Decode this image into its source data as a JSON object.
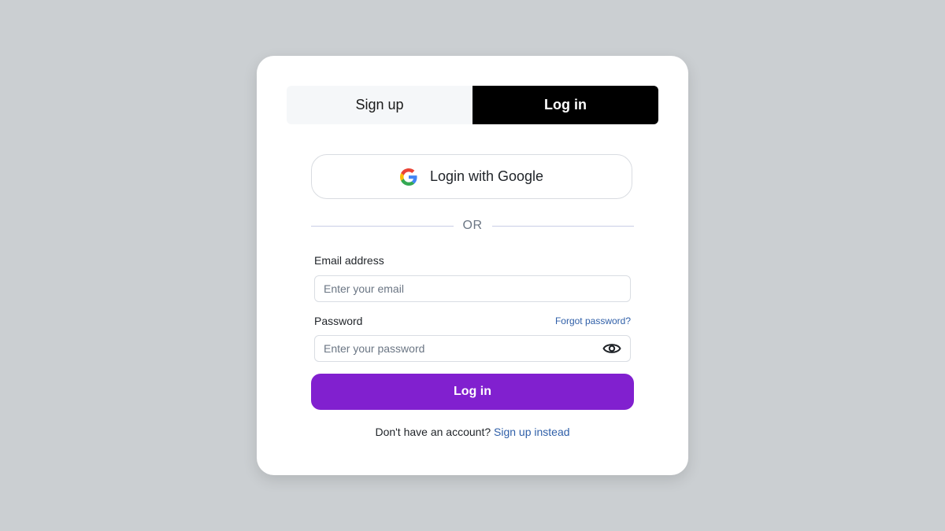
{
  "tabs": {
    "signup_label": "Sign up",
    "login_label": "Log in",
    "active": "login"
  },
  "google": {
    "label": "Login with Google",
    "icon": "google-icon"
  },
  "divider_text": "OR",
  "email": {
    "label": "Email address",
    "placeholder": "Enter your email",
    "value": ""
  },
  "password": {
    "label": "Password",
    "placeholder": "Enter your password",
    "value": "",
    "forgot_label": "Forgot password?",
    "toggle_icon": "eye-icon"
  },
  "submit_label": "Log in",
  "footer": {
    "prompt": "Don't have an account?",
    "link": "Sign up instead"
  },
  "colors": {
    "background": "#cbcfd2",
    "primary": "#8120cf",
    "active_tab": "#000000",
    "link": "#2f5fa8"
  }
}
